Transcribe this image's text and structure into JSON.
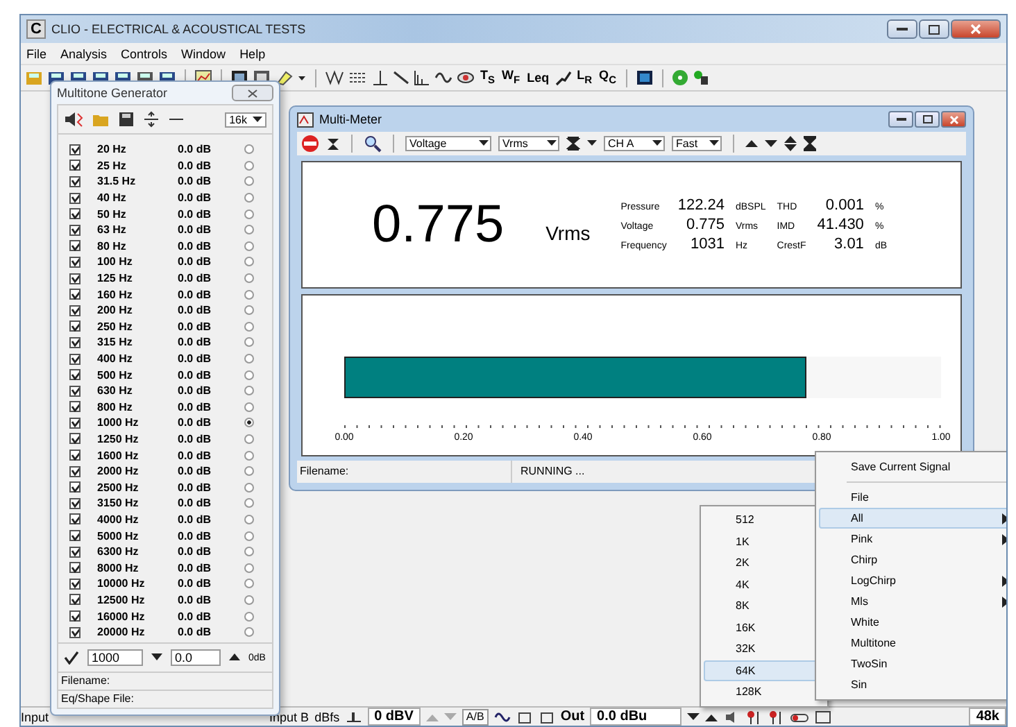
{
  "window": {
    "title": "CLIO - ELECTRICAL & ACOUSTICAL TESTS",
    "logo": "C"
  },
  "menu": [
    "File",
    "Analysis",
    "Controls",
    "Window",
    "Help"
  ],
  "toolbar_labels": [
    "T$_{S}$",
    "W$_{F}$",
    "Leq",
    "L$_{R}$",
    "Q$_{C}$"
  ],
  "multitone": {
    "title": "Multitone Generator",
    "size": "16k",
    "tones": [
      {
        "freq": "20 Hz",
        "level": "0.0 dB",
        "checked": true,
        "selected": false
      },
      {
        "freq": "25 Hz",
        "level": "0.0 dB",
        "checked": true,
        "selected": false
      },
      {
        "freq": "31.5 Hz",
        "level": "0.0 dB",
        "checked": true,
        "selected": false
      },
      {
        "freq": "40 Hz",
        "level": "0.0 dB",
        "checked": true,
        "selected": false
      },
      {
        "freq": "50 Hz",
        "level": "0.0 dB",
        "checked": true,
        "selected": false
      },
      {
        "freq": "63 Hz",
        "level": "0.0 dB",
        "checked": true,
        "selected": false
      },
      {
        "freq": "80 Hz",
        "level": "0.0 dB",
        "checked": true,
        "selected": false
      },
      {
        "freq": "100 Hz",
        "level": "0.0 dB",
        "checked": true,
        "selected": false
      },
      {
        "freq": "125 Hz",
        "level": "0.0 dB",
        "checked": true,
        "selected": false
      },
      {
        "freq": "160 Hz",
        "level": "0.0 dB",
        "checked": true,
        "selected": false
      },
      {
        "freq": "200 Hz",
        "level": "0.0 dB",
        "checked": true,
        "selected": false
      },
      {
        "freq": "250 Hz",
        "level": "0.0 dB",
        "checked": true,
        "selected": false
      },
      {
        "freq": "315 Hz",
        "level": "0.0 dB",
        "checked": true,
        "selected": false
      },
      {
        "freq": "400 Hz",
        "level": "0.0 dB",
        "checked": true,
        "selected": false
      },
      {
        "freq": "500 Hz",
        "level": "0.0 dB",
        "checked": true,
        "selected": false
      },
      {
        "freq": "630 Hz",
        "level": "0.0 dB",
        "checked": true,
        "selected": false
      },
      {
        "freq": "800 Hz",
        "level": "0.0 dB",
        "checked": true,
        "selected": false
      },
      {
        "freq": "1000 Hz",
        "level": "0.0 dB",
        "checked": true,
        "selected": true
      },
      {
        "freq": "1250 Hz",
        "level": "0.0 dB",
        "checked": true,
        "selected": false
      },
      {
        "freq": "1600 Hz",
        "level": "0.0 dB",
        "checked": true,
        "selected": false
      },
      {
        "freq": "2000 Hz",
        "level": "0.0 dB",
        "checked": true,
        "selected": false
      },
      {
        "freq": "2500 Hz",
        "level": "0.0 dB",
        "checked": true,
        "selected": false
      },
      {
        "freq": "3150 Hz",
        "level": "0.0 dB",
        "checked": true,
        "selected": false
      },
      {
        "freq": "4000 Hz",
        "level": "0.0 dB",
        "checked": true,
        "selected": false
      },
      {
        "freq": "5000 Hz",
        "level": "0.0 dB",
        "checked": true,
        "selected": false
      },
      {
        "freq": "6300 Hz",
        "level": "0.0 dB",
        "checked": true,
        "selected": false
      },
      {
        "freq": "8000 Hz",
        "level": "0.0 dB",
        "checked": true,
        "selected": false
      },
      {
        "freq": "10000 Hz",
        "level": "0.0 dB",
        "checked": true,
        "selected": false
      },
      {
        "freq": "12500 Hz",
        "level": "0.0 dB",
        "checked": true,
        "selected": false
      },
      {
        "freq": "16000 Hz",
        "level": "0.0 dB",
        "checked": true,
        "selected": false
      },
      {
        "freq": "20000 Hz",
        "level": "0.0 dB",
        "checked": true,
        "selected": false
      }
    ],
    "freq_value": "1000",
    "level_value": "0.0",
    "level_unit": "0dB",
    "filename_label": "Filename:",
    "eq_label": "Eq/Shape File:"
  },
  "meter": {
    "title": "Multi-Meter",
    "quantity": "Voltage",
    "unit_select": "Vrms",
    "channel": "CH A",
    "speed": "Fast",
    "value": "0.775",
    "unit": "Vrms",
    "readings": [
      {
        "label": "Pressure",
        "value": "122.24",
        "unit": "dBSPL"
      },
      {
        "label": "THD",
        "value": "0.001",
        "unit": "%"
      },
      {
        "label": "Voltage",
        "value": "0.775",
        "unit": "Vrms"
      },
      {
        "label": "IMD",
        "value": "41.430",
        "unit": "%"
      },
      {
        "label": "Frequency",
        "value": "1031",
        "unit": "Hz"
      },
      {
        "label": "CrestF",
        "value": "3.01",
        "unit": "dB"
      }
    ],
    "bar": {
      "level": 0.775,
      "ticks": [
        "0.00",
        "0.20",
        "0.40",
        "0.60",
        "0.80",
        "1.00"
      ]
    },
    "filename_label": "Filename:",
    "status": "RUNNING ..."
  },
  "context_menu": [
    {
      "kind": "item",
      "label": "Save Current Signal",
      "submenu": false,
      "selected": false
    },
    {
      "kind": "separator"
    },
    {
      "kind": "item",
      "label": "File",
      "submenu": false,
      "selected": false
    },
    {
      "kind": "item",
      "label": "All",
      "submenu": true,
      "selected": true
    },
    {
      "kind": "item",
      "label": "Pink",
      "submenu": true,
      "selected": false
    },
    {
      "kind": "item",
      "label": "Chirp",
      "submenu": false,
      "selected": false
    },
    {
      "kind": "item",
      "label": "LogChirp",
      "submenu": true,
      "selected": false
    },
    {
      "kind": "item",
      "label": "Mls",
      "submenu": true,
      "selected": false
    },
    {
      "kind": "item",
      "label": "White",
      "submenu": false,
      "selected": false
    },
    {
      "kind": "item",
      "label": "Multitone",
      "submenu": false,
      "selected": false
    },
    {
      "kind": "item",
      "label": "TwoSin",
      "submenu": false,
      "selected": false
    },
    {
      "kind": "item",
      "label": "Sin",
      "submenu": false,
      "selected": false
    }
  ],
  "submenu": [
    {
      "label": "512",
      "selected": false
    },
    {
      "label": "1K",
      "selected": false
    },
    {
      "label": "2K",
      "selected": false
    },
    {
      "label": "4K",
      "selected": false
    },
    {
      "label": "8K",
      "selected": false
    },
    {
      "label": "16K",
      "selected": false
    },
    {
      "label": "32K",
      "selected": false
    },
    {
      "label": "64K",
      "selected": true
    },
    {
      "label": "128K",
      "selected": false
    }
  ],
  "status_bar": {
    "input_a": "Input",
    "input_b": "Input B",
    "dbfs": "dBfs",
    "input_level": "0 dBV",
    "ab": "A/B",
    "out": "Out",
    "out_level": "0.0 dBu",
    "rate": "48k"
  }
}
